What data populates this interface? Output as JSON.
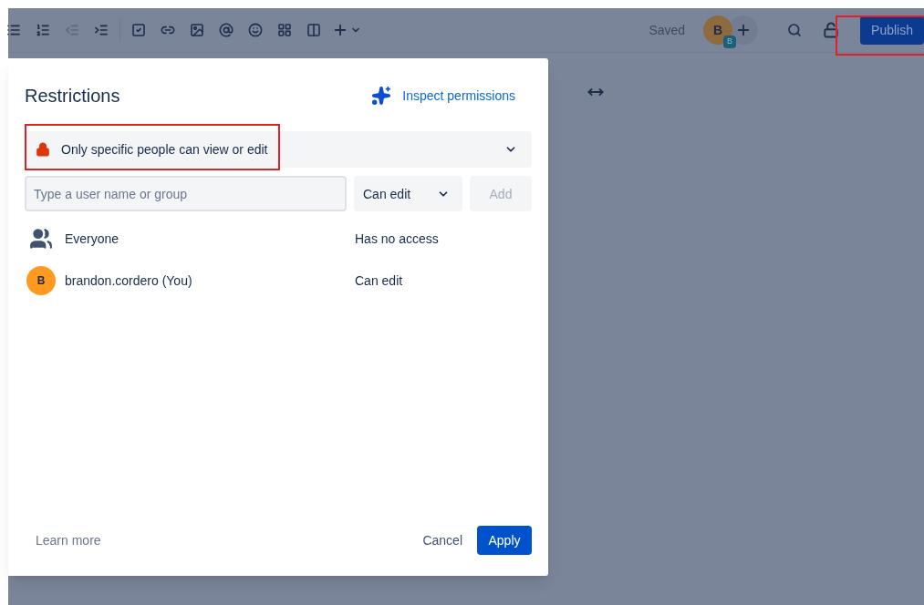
{
  "toolbar": {
    "tools": [
      {
        "kind": "bullet-list"
      },
      {
        "kind": "numbered-list"
      },
      {
        "kind": "outdent",
        "disabled": true
      },
      {
        "kind": "indent",
        "disabled": false
      },
      {
        "kind": "divider"
      },
      {
        "kind": "task"
      },
      {
        "kind": "link"
      },
      {
        "kind": "image"
      },
      {
        "kind": "mention"
      },
      {
        "kind": "emoji"
      },
      {
        "kind": "table"
      },
      {
        "kind": "layout"
      },
      {
        "kind": "insert"
      }
    ],
    "status": "Saved",
    "avatar": {
      "initial": "B",
      "badge": "B"
    },
    "publish": {
      "label": "Publish",
      "highlighted": true
    }
  },
  "dialog": {
    "title": "Restrictions",
    "inspect_link": "Inspect permissions",
    "restriction": {
      "label": "Only specific people can view or edit",
      "highlighted": true
    },
    "search": {
      "placeholder": "Type a user name or group"
    },
    "permission_select": {
      "value": "Can edit"
    },
    "add_button": {
      "label": "Add",
      "disabled": true
    },
    "entries": [
      {
        "kind": "group",
        "name": "Everyone",
        "access": "Has no access"
      },
      {
        "kind": "user",
        "initial": "B",
        "name": "brandon.cordero (You)",
        "access": "Can edit"
      }
    ],
    "learn_more": "Learn more",
    "cancel": "Cancel",
    "apply": "Apply"
  }
}
